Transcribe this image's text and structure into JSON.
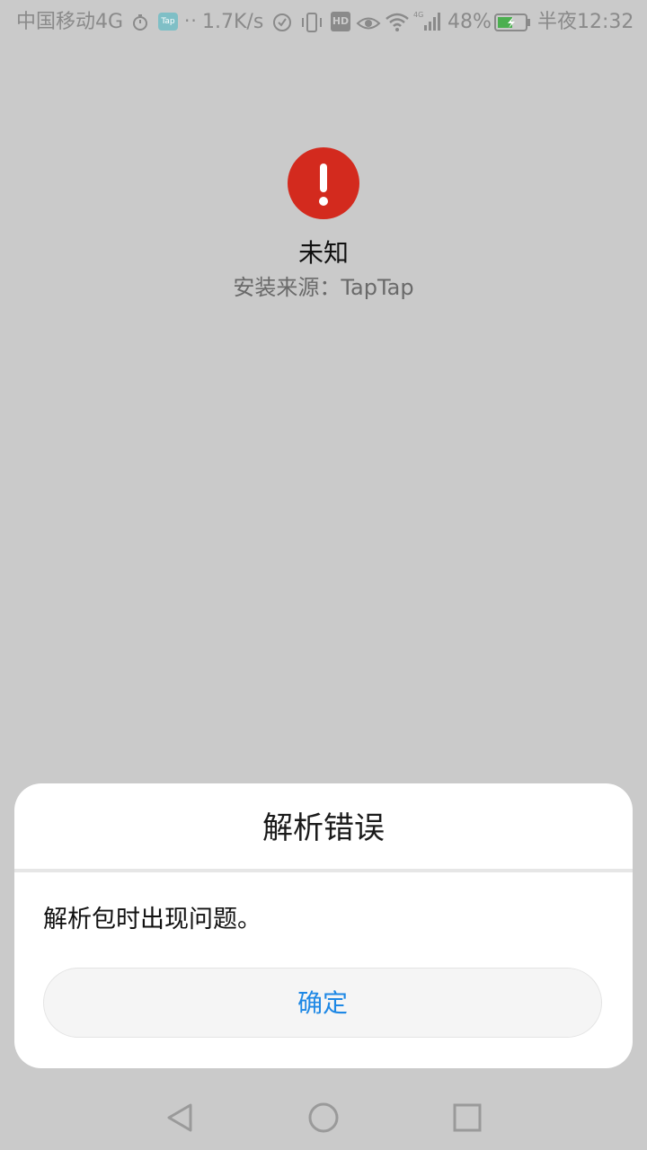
{
  "status_bar": {
    "carrier": "中国移动4G",
    "tap_badge": "Tap",
    "dots": "··",
    "network_speed": "1.7K/s",
    "hd_badge": "HD",
    "battery_percent": "48%",
    "time": "半夜12:32",
    "icons": [
      "timer-icon",
      "taptap-notification-icon",
      "sync-icon",
      "vibrate-icon",
      "hd-icon",
      "eye-comfort-icon",
      "wifi-icon",
      "signal-icon",
      "battery-icon"
    ]
  },
  "app": {
    "name": "未知",
    "source": "安装来源：TapTap",
    "icon": "error-exclamation-icon",
    "icon_color": "#d32a1e"
  },
  "dialog": {
    "title": "解析错误",
    "message": "解析包时出现问题。",
    "confirm_label": "确定",
    "confirm_color": "#1e88e5"
  },
  "nav_bar": {
    "icons": [
      "back-icon",
      "home-icon",
      "recents-icon"
    ]
  }
}
